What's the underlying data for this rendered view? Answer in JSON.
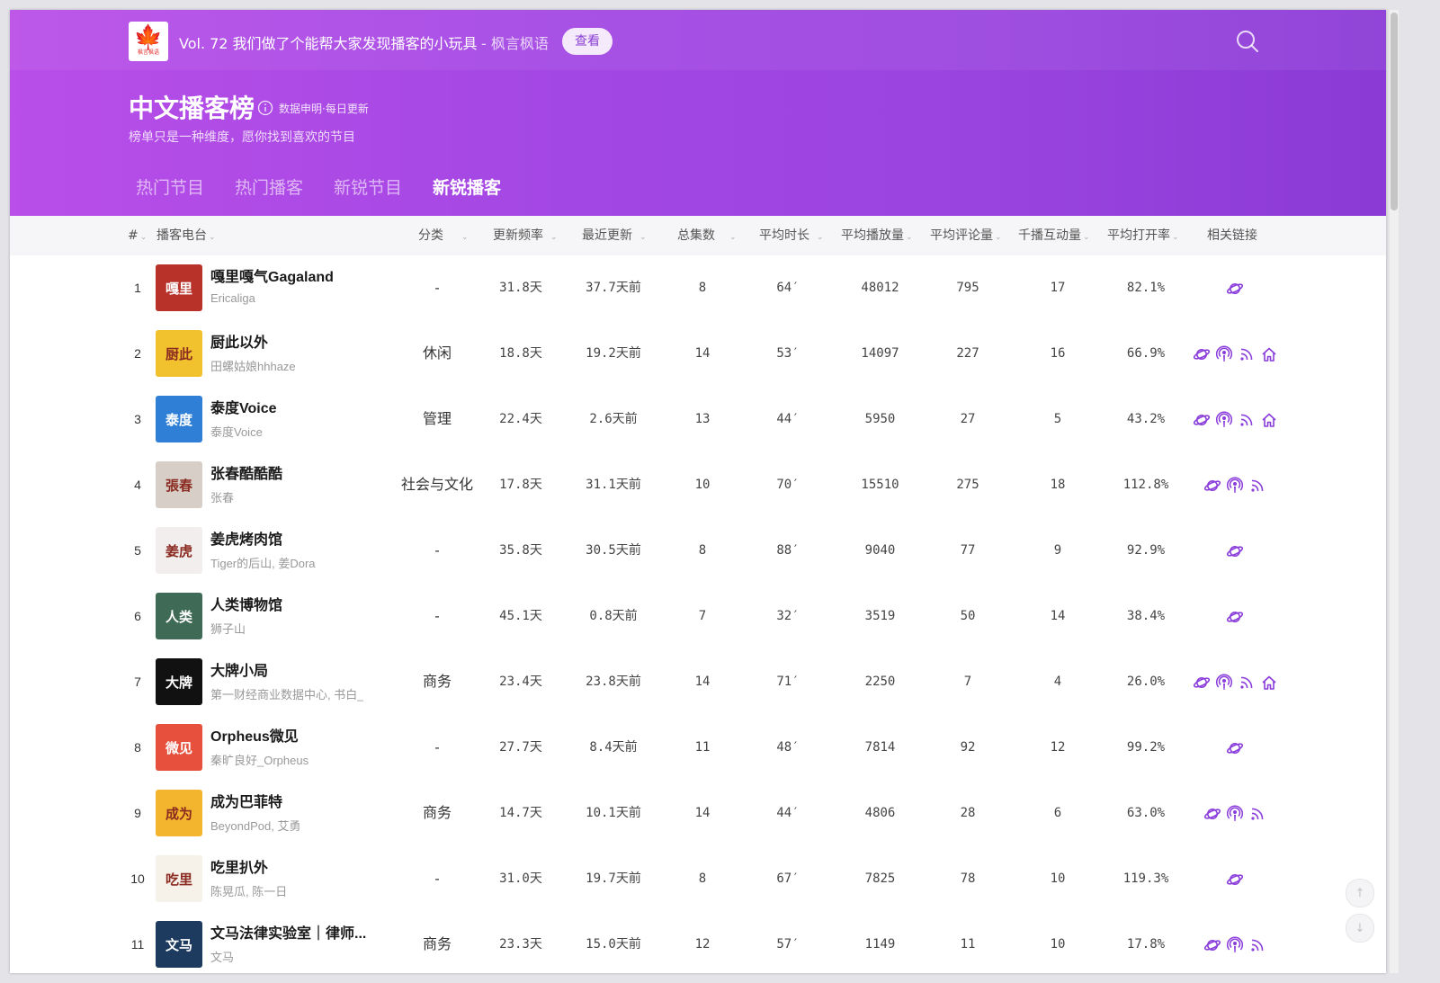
{
  "banner": {
    "episode_title": "Vol. 72 我们做了个能帮大家发现播客的小玩具",
    "episode_source": "- 枫言枫语",
    "view_button": "查看",
    "logo_text": "枫言枫语"
  },
  "header": {
    "title": "中文播客榜",
    "info_label": "数据申明·每日更新",
    "subtitle": "榜单只是一种维度，愿你找到喜欢的节目"
  },
  "tabs": [
    {
      "label": "热门节目"
    },
    {
      "label": "热门播客"
    },
    {
      "label": "新锐节目"
    },
    {
      "label": "新锐播客"
    }
  ],
  "active_tab": "新锐播客",
  "columns": {
    "rank": "#",
    "name": "播客电台",
    "category": "分类",
    "frequency": "更新频率",
    "last_update": "最近更新",
    "episodes": "总集数",
    "avg_duration": "平均时长",
    "avg_plays": "平均播放量",
    "avg_comments": "平均评论量",
    "interaction": "千播互动量",
    "open_rate": "平均打开率",
    "links": "相关链接"
  },
  "colors": {
    "accent": "#9b45e0",
    "link_icon": "#8a3ddb"
  },
  "rows": [
    {
      "rank": "1",
      "name": "嘎里嘎气Gagaland",
      "author": "Ericaliga",
      "category": "-",
      "frequency": "31.8天",
      "last_update": "37.7天前",
      "episodes": "8",
      "avg_duration": "64′",
      "avg_plays": "48012",
      "avg_comments": "795",
      "interaction": "17",
      "open_rate": "82.1%",
      "cover_text": "嘎里",
      "cover_color": "#b8322a",
      "links": [
        "planet-icon"
      ]
    },
    {
      "rank": "2",
      "name": "厨此以外",
      "author": "田螺姑娘hhhaze",
      "category": "休闲",
      "frequency": "18.8天",
      "last_update": "19.2天前",
      "episodes": "14",
      "avg_duration": "53′",
      "avg_plays": "14097",
      "avg_comments": "227",
      "interaction": "16",
      "open_rate": "66.9%",
      "cover_text": "厨此",
      "cover_color": "#f2c12e",
      "links": [
        "planet-icon",
        "podcast-icon",
        "rss-icon",
        "home-icon"
      ]
    },
    {
      "rank": "3",
      "name": "泰度Voice",
      "author": "泰度Voice",
      "category": "管理",
      "frequency": "22.4天",
      "last_update": "2.6天前",
      "episodes": "13",
      "avg_duration": "44′",
      "avg_plays": "5950",
      "avg_comments": "27",
      "interaction": "5",
      "open_rate": "43.2%",
      "cover_text": "泰度",
      "cover_color": "#2f7fd6",
      "links": [
        "planet-icon",
        "podcast-icon",
        "rss-icon",
        "home-icon"
      ]
    },
    {
      "rank": "4",
      "name": "张春酷酷酷",
      "author": "张春",
      "category": "社会与文化",
      "frequency": "17.8天",
      "last_update": "31.1天前",
      "episodes": "10",
      "avg_duration": "70′",
      "avg_plays": "15510",
      "avg_comments": "275",
      "interaction": "18",
      "open_rate": "112.8%",
      "cover_text": "張春",
      "cover_color": "#d7cfc7",
      "links": [
        "planet-icon",
        "podcast-icon",
        "rss-icon"
      ]
    },
    {
      "rank": "5",
      "name": "姜虎烤肉馆",
      "author": "Tiger的后山, 姜Dora",
      "category": "-",
      "frequency": "35.8天",
      "last_update": "30.5天前",
      "episodes": "8",
      "avg_duration": "88′",
      "avg_plays": "9040",
      "avg_comments": "77",
      "interaction": "9",
      "open_rate": "92.9%",
      "cover_text": "姜虎",
      "cover_color": "#f3eeee",
      "links": [
        "planet-icon"
      ]
    },
    {
      "rank": "6",
      "name": "人类博物馆",
      "author": "狮子山",
      "category": "-",
      "frequency": "45.1天",
      "last_update": "0.8天前",
      "episodes": "7",
      "avg_duration": "32′",
      "avg_plays": "3519",
      "avg_comments": "50",
      "interaction": "14",
      "open_rate": "38.4%",
      "cover_text": "人类",
      "cover_color": "#3f6a55",
      "links": [
        "planet-icon"
      ]
    },
    {
      "rank": "7",
      "name": "大牌小局",
      "author": "第一财经商业数据中心, 书白_",
      "category": "商务",
      "frequency": "23.4天",
      "last_update": "23.8天前",
      "episodes": "14",
      "avg_duration": "71′",
      "avg_plays": "2250",
      "avg_comments": "7",
      "interaction": "4",
      "open_rate": "26.0%",
      "cover_text": "大牌",
      "cover_color": "#111111",
      "links": [
        "planet-icon",
        "podcast-icon",
        "rss-icon",
        "home-icon"
      ]
    },
    {
      "rank": "8",
      "name": "Orpheus微见",
      "author": "秦旷良好_Orpheus",
      "category": "-",
      "frequency": "27.7天",
      "last_update": "8.4天前",
      "episodes": "11",
      "avg_duration": "48′",
      "avg_plays": "7814",
      "avg_comments": "92",
      "interaction": "12",
      "open_rate": "99.2%",
      "cover_text": "微见",
      "cover_color": "#e6503c",
      "links": [
        "planet-icon"
      ]
    },
    {
      "rank": "9",
      "name": "成为巴菲特",
      "author": "BeyondPod, 艾勇",
      "category": "商务",
      "frequency": "14.7天",
      "last_update": "10.1天前",
      "episodes": "14",
      "avg_duration": "44′",
      "avg_plays": "4806",
      "avg_comments": "28",
      "interaction": "6",
      "open_rate": "63.0%",
      "cover_text": "成为",
      "cover_color": "#f3b52d",
      "links": [
        "planet-icon",
        "podcast-icon",
        "rss-icon"
      ]
    },
    {
      "rank": "10",
      "name": "吃里扒外",
      "author": "陈晃瓜, 陈一日",
      "category": "-",
      "frequency": "31.0天",
      "last_update": "19.7天前",
      "episodes": "8",
      "avg_duration": "67′",
      "avg_plays": "7825",
      "avg_comments": "78",
      "interaction": "10",
      "open_rate": "119.3%",
      "cover_text": "吃里",
      "cover_color": "#f6f2ea",
      "links": [
        "planet-icon"
      ]
    },
    {
      "rank": "11",
      "name": "文马法律实验室｜律师...",
      "author": "文马",
      "category": "商务",
      "frequency": "23.3天",
      "last_update": "15.0天前",
      "episodes": "12",
      "avg_duration": "57′",
      "avg_plays": "1149",
      "avg_comments": "11",
      "interaction": "10",
      "open_rate": "17.8%",
      "cover_text": "文马",
      "cover_color": "#1d3a5f",
      "links": [
        "planet-icon",
        "podcast-icon",
        "rss-icon"
      ]
    }
  ]
}
